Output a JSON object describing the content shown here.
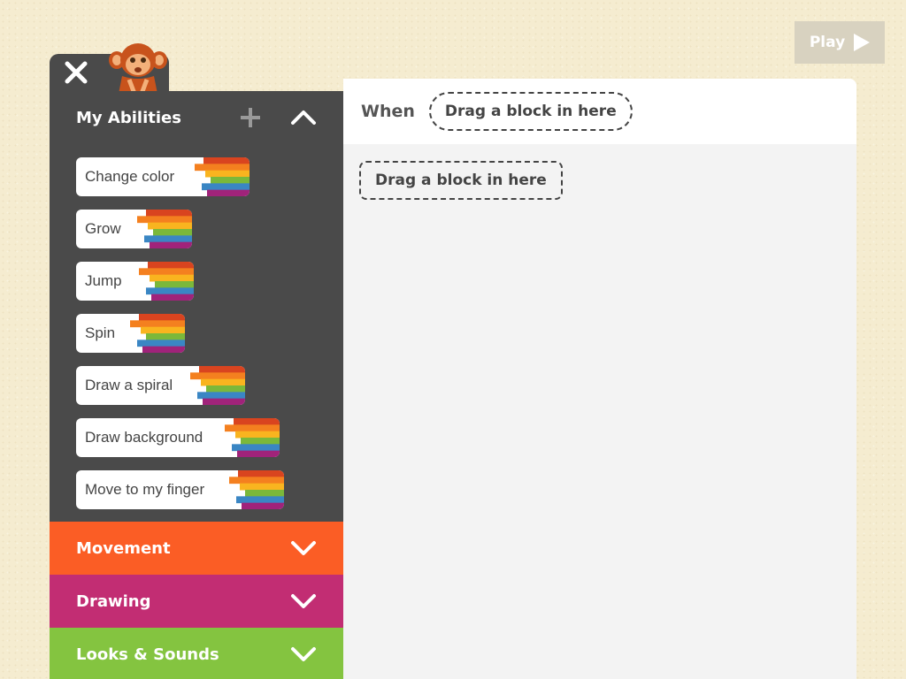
{
  "play": {
    "label": "Play"
  },
  "panel": {
    "title": "My Abilities",
    "blocks": [
      {
        "label": "Change color",
        "width": 196
      },
      {
        "label": "Grow",
        "width": 131
      },
      {
        "label": "Jump",
        "width": 133
      },
      {
        "label": "Spin",
        "width": 123
      },
      {
        "label": "Draw a spiral",
        "width": 191
      },
      {
        "label": "Draw background",
        "width": 230
      },
      {
        "label": "Move to my finger",
        "width": 235
      }
    ],
    "categories": [
      {
        "label": "Movement",
        "color": "#fb5d25"
      },
      {
        "label": "Drawing",
        "color": "#c22d73"
      },
      {
        "label": "Looks & Sounds",
        "color": "#84c440"
      }
    ]
  },
  "workspace": {
    "when_label": "When",
    "when_slot": "Drag a block in here",
    "body_slot": "Drag a block in here"
  },
  "icons": {
    "close": "close-icon",
    "plus": "plus-icon",
    "collapse": "chevron-up-icon",
    "expand": "chevron-down-icon",
    "play": "play-icon",
    "character": "monkey-avatar"
  }
}
